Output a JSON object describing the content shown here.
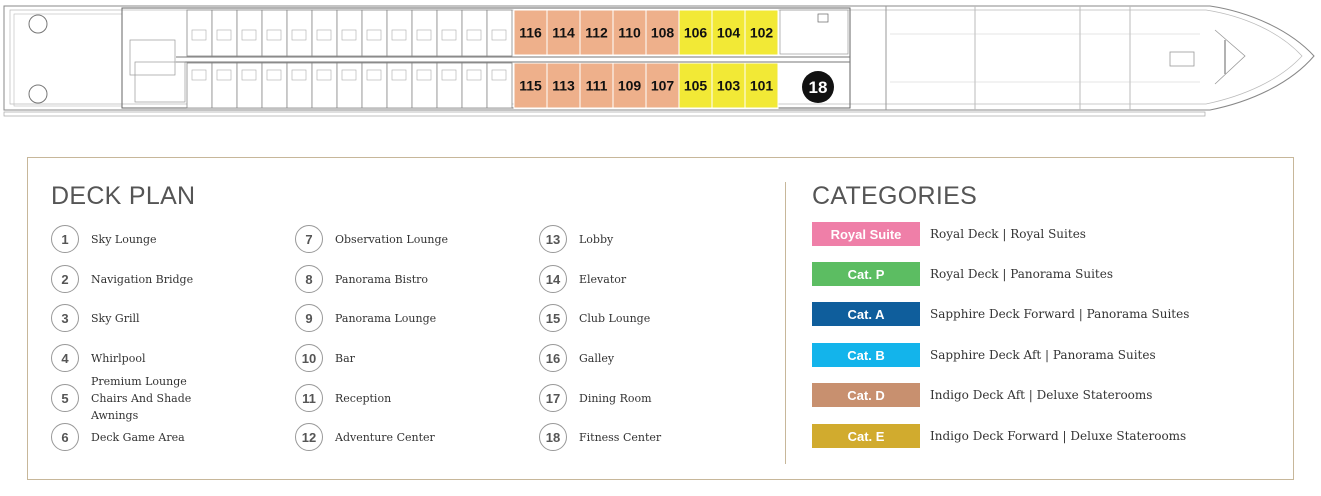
{
  "ship": {
    "fitness_marker": "18",
    "cabins_top": [
      {
        "label": "116",
        "color": "#eeb08b"
      },
      {
        "label": "114",
        "color": "#eeb08b"
      },
      {
        "label": "112",
        "color": "#eeb08b"
      },
      {
        "label": "110",
        "color": "#eeb08b"
      },
      {
        "label": "108",
        "color": "#eeb08b"
      },
      {
        "label": "106",
        "color": "#f2e936"
      },
      {
        "label": "104",
        "color": "#f2e936"
      },
      {
        "label": "102",
        "color": "#f2e936"
      }
    ],
    "cabins_bottom": [
      {
        "label": "115",
        "color": "#eeb08b"
      },
      {
        "label": "113",
        "color": "#eeb08b"
      },
      {
        "label": "111",
        "color": "#eeb08b"
      },
      {
        "label": "109",
        "color": "#eeb08b"
      },
      {
        "label": "107",
        "color": "#eeb08b"
      },
      {
        "label": "105",
        "color": "#f2e936"
      },
      {
        "label": "103",
        "color": "#f2e936"
      },
      {
        "label": "101",
        "color": "#f2e936"
      }
    ]
  },
  "deck_plan": {
    "title": "DECK PLAN",
    "items": [
      {
        "num": "1",
        "label": "Sky Lounge"
      },
      {
        "num": "2",
        "label": "Navigation Bridge"
      },
      {
        "num": "3",
        "label": "Sky Grill"
      },
      {
        "num": "4",
        "label": "Whirlpool"
      },
      {
        "num": "5",
        "label": "Premium Lounge\nChairs And Shade\nAwnings"
      },
      {
        "num": "6",
        "label": "Deck Game Area"
      },
      {
        "num": "7",
        "label": "Observation Lounge"
      },
      {
        "num": "8",
        "label": "Panorama Bistro"
      },
      {
        "num": "9",
        "label": "Panorama Lounge"
      },
      {
        "num": "10",
        "label": "Bar"
      },
      {
        "num": "11",
        "label": "Reception"
      },
      {
        "num": "12",
        "label": "Adventure Center"
      },
      {
        "num": "13",
        "label": "Lobby"
      },
      {
        "num": "14",
        "label": "Elevator"
      },
      {
        "num": "15",
        "label": "Club Lounge"
      },
      {
        "num": "16",
        "label": "Galley"
      },
      {
        "num": "17",
        "label": "Dining Room"
      },
      {
        "num": "18",
        "label": "Fitness Center"
      }
    ]
  },
  "categories": {
    "title": "CATEGORIES",
    "items": [
      {
        "badge": "Royal Suite",
        "color": "#ef7fa8",
        "desc": "Royal Deck | Royal Suites"
      },
      {
        "badge": "Cat. P",
        "color": "#5cbd62",
        "desc": "Royal Deck | Panorama Suites"
      },
      {
        "badge": "Cat. A",
        "color": "#0f5e9c",
        "desc": "Sapphire Deck Forward | Panorama Suites"
      },
      {
        "badge": "Cat. B",
        "color": "#13b4eb",
        "desc": "Sapphire Deck Aft | Panorama Suites"
      },
      {
        "badge": "Cat. D",
        "color": "#c8906f",
        "desc": "Indigo Deck Aft | Deluxe Staterooms"
      },
      {
        "badge": "Cat. E",
        "color": "#d1ab2e",
        "desc": "Indigo Deck Forward | Deluxe Staterooms"
      }
    ]
  }
}
